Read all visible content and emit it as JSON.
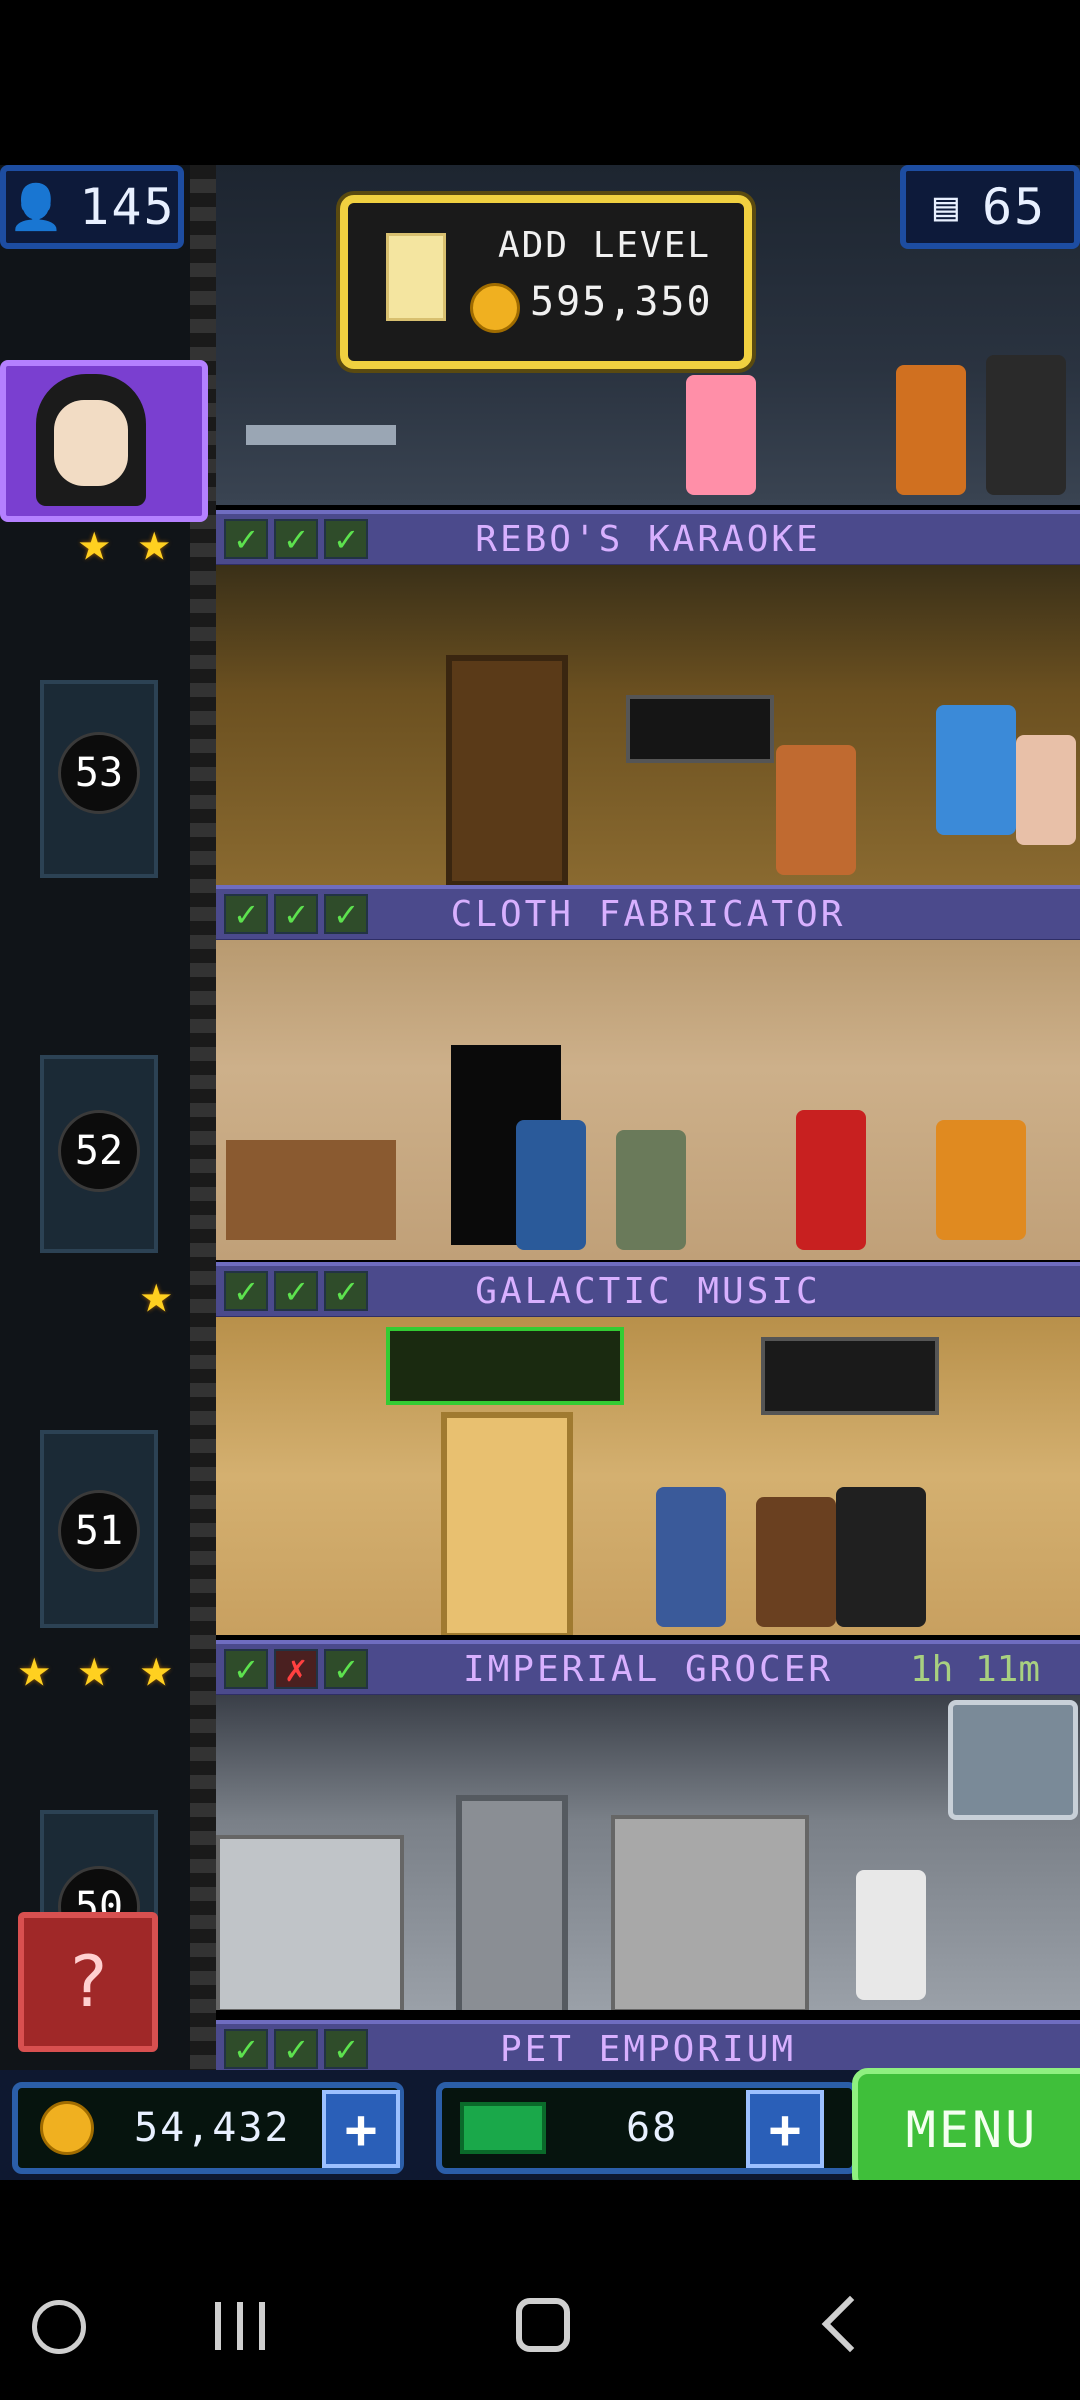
{
  "hud": {
    "population": "145",
    "floors": "65"
  },
  "add_level": {
    "label": "ADD LEVEL",
    "cost": "595,350"
  },
  "floors": [
    {
      "name": "REBO'S KARAOKE",
      "checks": [
        "ok",
        "ok",
        "ok"
      ],
      "timer": "",
      "elevator_level": "53"
    },
    {
      "name": "CLOTH FABRICATOR",
      "checks": [
        "ok",
        "ok",
        "ok"
      ],
      "timer": "",
      "elevator_level": "52"
    },
    {
      "name": "GALACTIC MUSIC",
      "checks": [
        "ok",
        "ok",
        "ok"
      ],
      "timer": "",
      "elevator_level": "51"
    },
    {
      "name": "IMPERIAL GROCER",
      "checks": [
        "ok",
        "x",
        "ok"
      ],
      "timer": "1h 11m",
      "elevator_level": "50"
    },
    {
      "name": "PET EMPORIUM",
      "checks": [
        "ok",
        "ok",
        "ok"
      ],
      "timer": "",
      "elevator_level": ""
    }
  ],
  "bottom": {
    "coins": "54,432",
    "bux": "68",
    "menu_label": "MENU"
  },
  "glyphs": {
    "check": "✓",
    "x": "✗",
    "plus": "+",
    "star": "★",
    "question": "?"
  },
  "colors": {
    "floor_header": "#4b4a8c",
    "accent_blue": "#1d4da1",
    "menu_green": "#3fbf3a",
    "coin_gold": "#f0b020"
  }
}
